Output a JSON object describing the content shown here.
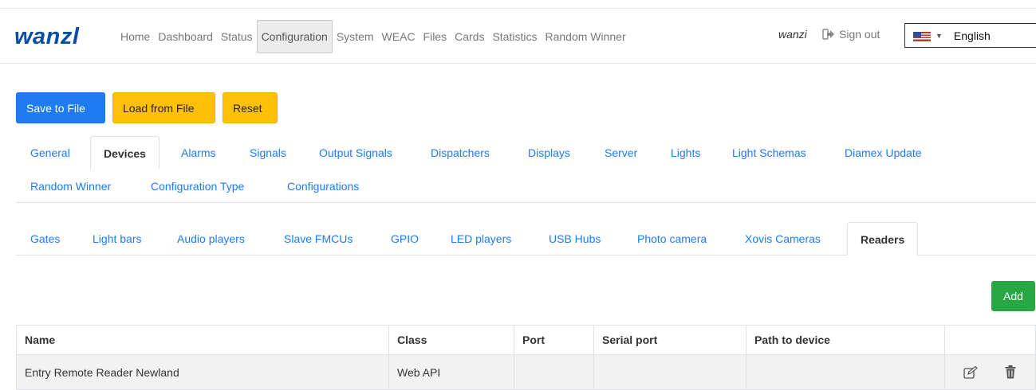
{
  "brand": {
    "logo": "wanzl",
    "primary_color": "#0a4ea3"
  },
  "nav": {
    "links": [
      "Home",
      "Dashboard",
      "Status",
      "Configuration",
      "System",
      "WEAC",
      "Files",
      "Cards",
      "Statistics",
      "Random Winner"
    ],
    "active": "Configuration",
    "user": "wanzi",
    "signout_label": "Sign out",
    "language": "English",
    "language_icon": "us-flag-icon"
  },
  "toolbar": {
    "save_label": "Save to File",
    "load_label": "Load from File",
    "reset_label": "Reset"
  },
  "main_tabs": {
    "row1": [
      "General",
      "Devices",
      "Alarms",
      "Signals",
      "Output Signals",
      "Dispatchers",
      "Displays",
      "Server",
      "Lights",
      "Light Schemas",
      "Diamex Update"
    ],
    "row2": [
      "Random Winner",
      "Configuration Type",
      "Configurations"
    ],
    "active": "Devices"
  },
  "sub_tabs": {
    "items": [
      "Gates",
      "Light bars",
      "Audio players",
      "Slave FMCUs",
      "GPIO",
      "LED players",
      "USB Hubs",
      "Photo camera",
      "Xovis Cameras",
      "Readers"
    ],
    "active": "Readers"
  },
  "add_label": "Add",
  "table": {
    "headers": [
      "Name",
      "Class",
      "Port",
      "Serial port",
      "Path to device",
      ""
    ],
    "rows": [
      [
        "Entry Remote Reader Newland",
        "Web API",
        "",
        "",
        "",
        ""
      ]
    ]
  },
  "colors": {
    "link": "#1f7bf2",
    "primary": "#1f7bf2",
    "warning": "#ffc107",
    "success": "#28a745"
  }
}
